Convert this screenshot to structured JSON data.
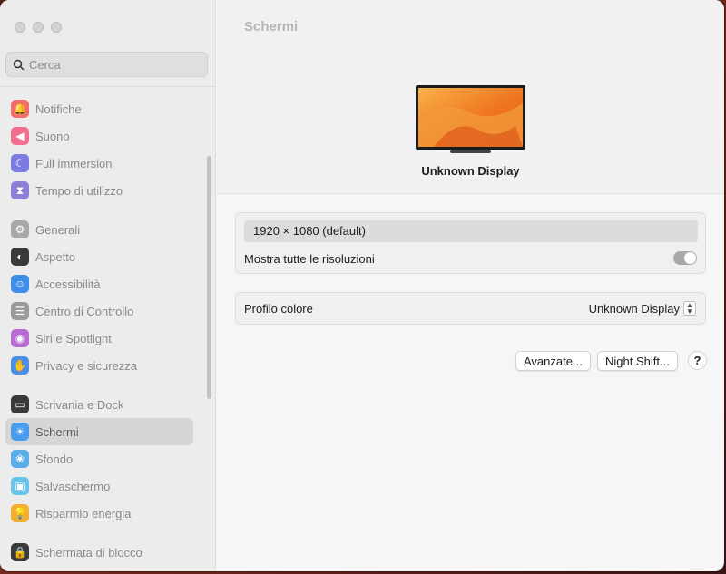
{
  "search": {
    "placeholder": "Cerca"
  },
  "sidebar": {
    "groups": [
      [
        {
          "label": "Notifiche",
          "icon": "bell-icon",
          "color": "#f26d6d"
        },
        {
          "label": "Suono",
          "icon": "speaker-icon",
          "color": "#f06f8e"
        },
        {
          "label": "Full immersion",
          "icon": "moon-icon",
          "color": "#7c7ce0"
        },
        {
          "label": "Tempo di utilizzo",
          "icon": "hourglass-icon",
          "color": "#8b7fd6"
        }
      ],
      [
        {
          "label": "Generali",
          "icon": "gear-icon",
          "color": "#a8a8a8"
        },
        {
          "label": "Aspetto",
          "icon": "appearance-icon",
          "color": "#3a3a3a"
        },
        {
          "label": "Accessibilità",
          "icon": "accessibility-icon",
          "color": "#3f8ee8"
        },
        {
          "label": "Centro di Controllo",
          "icon": "control-center-icon",
          "color": "#9a9a9a"
        },
        {
          "label": "Siri e Spotlight",
          "icon": "siri-icon",
          "color": "#b86bd1"
        },
        {
          "label": "Privacy e sicurezza",
          "icon": "hand-icon",
          "color": "#4a8fe6"
        }
      ],
      [
        {
          "label": "Scrivania e Dock",
          "icon": "dock-icon",
          "color": "#3a3a3a"
        },
        {
          "label": "Schermi",
          "icon": "brightness-icon",
          "color": "#4a9aee",
          "selected": true
        },
        {
          "label": "Sfondo",
          "icon": "wallpaper-icon",
          "color": "#5aaee8"
        },
        {
          "label": "Salvaschermo",
          "icon": "screensaver-icon",
          "color": "#6ac3e8"
        },
        {
          "label": "Risparmio energia",
          "icon": "lightbulb-icon",
          "color": "#f2b033"
        }
      ],
      [
        {
          "label": "Schermata di blocco",
          "icon": "lock-icon",
          "color": "#3a3a3a"
        }
      ]
    ]
  },
  "main": {
    "title": "Schermi",
    "display_name": "Unknown Display",
    "resolution": "1920 × 1080 (default)",
    "show_all_label": "Mostra tutte le risoluzioni",
    "show_all_on": true,
    "color_profile_label": "Profilo colore",
    "color_profile_value": "Unknown Display",
    "advanced_button": "Avanzate...",
    "night_shift_button": "Night Shift...",
    "help_button": "?"
  },
  "colors": {
    "accent": "#4a9aee",
    "window_bg": "#f6f6f6",
    "sidebar_bg": "#ececec"
  }
}
